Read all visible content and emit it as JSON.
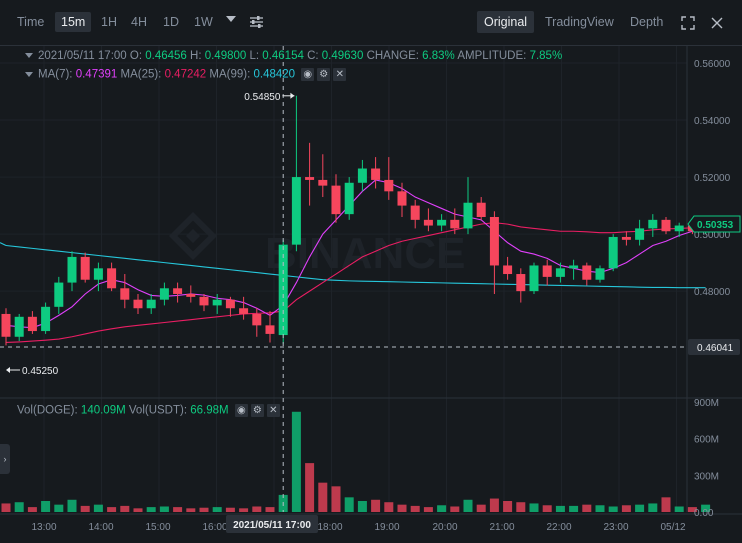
{
  "toolbar": {
    "intervals": [
      "Time",
      "15m",
      "1H",
      "4H",
      "1D",
      "1W"
    ],
    "active_interval": "15m",
    "views": [
      "Original",
      "TradingView",
      "Depth"
    ],
    "active_view": "Original"
  },
  "ohlc_line": {
    "date": "2021/05/11 17:00",
    "o_label": "O:",
    "o_value": "0.46456",
    "h_label": "H:",
    "h_value": "0.49800",
    "l_label": "L:",
    "l_value": "0.46154",
    "c_label": "C:",
    "c_value": "0.49630",
    "change_label": "CHANGE:",
    "change_value": "6.83%",
    "amp_label": "AMPLITUDE:",
    "amp_value": "7.85%"
  },
  "ma_line": {
    "ma7_label": "MA(7):",
    "ma7_value": "0.47391",
    "ma25_label": "MA(25):",
    "ma25_value": "0.47242",
    "ma99_label": "MA(99):",
    "ma99_value": "0.48420"
  },
  "vol_line": {
    "doge_label": "Vol(DOGE):",
    "doge_value": "140.09M",
    "usdt_label": "Vol(USDT):",
    "usdt_value": "66.98M"
  },
  "price_axis": [
    "0.56000",
    "0.54000",
    "0.52000",
    "0.50000",
    "0.48000",
    "0.46041"
  ],
  "vol_axis": [
    "900M",
    "600M",
    "300M",
    "0.00"
  ],
  "time_axis": [
    "13:00",
    "14:00",
    "15:00",
    "16:00",
    "18:00",
    "19:00",
    "20:00",
    "21:00",
    "22:00",
    "23:00",
    "05/12"
  ],
  "crosshair_time": "2021/05/11 17:00",
  "crosshair_price": "0.46041",
  "last_price": "0.50353",
  "high_marker": "0.54850",
  "low_marker": "0.45250",
  "watermark": "BINANCE",
  "colors": {
    "up": "#0ecb81",
    "down": "#f6465d",
    "ma7": "#e040fb",
    "ma25": "#e91e63",
    "ma99": "#26c6da"
  },
  "chart_data": {
    "type": "candlestick",
    "interval": "15m",
    "candles": [
      [
        0.472,
        0.474,
        0.461,
        0.464
      ],
      [
        0.464,
        0.472,
        0.4625,
        0.471
      ],
      [
        0.471,
        0.473,
        0.465,
        0.466
      ],
      [
        0.466,
        0.476,
        0.465,
        0.4745
      ],
      [
        0.4745,
        0.485,
        0.472,
        0.483
      ],
      [
        0.483,
        0.494,
        0.48,
        0.492
      ],
      [
        0.492,
        0.4935,
        0.483,
        0.484
      ],
      [
        0.484,
        0.49,
        0.48,
        0.488
      ],
      [
        0.488,
        0.49,
        0.48,
        0.481
      ],
      [
        0.481,
        0.486,
        0.474,
        0.477
      ],
      [
        0.477,
        0.479,
        0.472,
        0.474
      ],
      [
        0.474,
        0.479,
        0.472,
        0.477
      ],
      [
        0.477,
        0.483,
        0.475,
        0.481
      ],
      [
        0.481,
        0.483,
        0.476,
        0.479
      ],
      [
        0.479,
        0.482,
        0.476,
        0.478
      ],
      [
        0.478,
        0.479,
        0.473,
        0.475
      ],
      [
        0.475,
        0.479,
        0.472,
        0.477
      ],
      [
        0.477,
        0.478,
        0.471,
        0.474
      ],
      [
        0.474,
        0.478,
        0.47,
        0.472
      ],
      [
        0.472,
        0.474,
        0.464,
        0.468
      ],
      [
        0.468,
        0.473,
        0.462,
        0.465
      ],
      [
        0.4646,
        0.498,
        0.4615,
        0.4963
      ],
      [
        0.4963,
        0.5485,
        0.494,
        0.52
      ],
      [
        0.52,
        0.532,
        0.51,
        0.519
      ],
      [
        0.519,
        0.528,
        0.513,
        0.517
      ],
      [
        0.517,
        0.521,
        0.504,
        0.507
      ],
      [
        0.507,
        0.52,
        0.505,
        0.518
      ],
      [
        0.518,
        0.526,
        0.515,
        0.523
      ],
      [
        0.523,
        0.527,
        0.516,
        0.519
      ],
      [
        0.519,
        0.527,
        0.512,
        0.515
      ],
      [
        0.515,
        0.518,
        0.506,
        0.51
      ],
      [
        0.51,
        0.512,
        0.502,
        0.505
      ],
      [
        0.505,
        0.509,
        0.501,
        0.503
      ],
      [
        0.503,
        0.507,
        0.501,
        0.505
      ],
      [
        0.505,
        0.509,
        0.5,
        0.502
      ],
      [
        0.502,
        0.52,
        0.5,
        0.511
      ],
      [
        0.511,
        0.513,
        0.505,
        0.506
      ],
      [
        0.506,
        0.508,
        0.479,
        0.489
      ],
      [
        0.489,
        0.492,
        0.484,
        0.486
      ],
      [
        0.486,
        0.488,
        0.476,
        0.48
      ],
      [
        0.48,
        0.49,
        0.479,
        0.489
      ],
      [
        0.489,
        0.491,
        0.482,
        0.485
      ],
      [
        0.485,
        0.49,
        0.483,
        0.488
      ],
      [
        0.488,
        0.491,
        0.484,
        0.489
      ],
      [
        0.489,
        0.49,
        0.482,
        0.484
      ],
      [
        0.484,
        0.489,
        0.483,
        0.488
      ],
      [
        0.488,
        0.5,
        0.487,
        0.499
      ],
      [
        0.499,
        0.501,
        0.496,
        0.498
      ],
      [
        0.498,
        0.505,
        0.496,
        0.502
      ],
      [
        0.502,
        0.507,
        0.499,
        0.505
      ],
      [
        0.505,
        0.506,
        0.5,
        0.501
      ],
      [
        0.501,
        0.504,
        0.499,
        0.503
      ],
      [
        0.503,
        0.504,
        0.5,
        0.501
      ],
      [
        0.501,
        0.504,
        0.5,
        0.5035
      ]
    ],
    "volumes_millions": [
      70,
      80,
      40,
      90,
      60,
      100,
      50,
      60,
      40,
      50,
      30,
      40,
      45,
      40,
      30,
      35,
      40,
      35,
      30,
      45,
      40,
      140,
      820,
      400,
      240,
      210,
      120,
      90,
      100,
      80,
      60,
      50,
      40,
      55,
      45,
      100,
      60,
      110,
      90,
      80,
      70,
      55,
      50,
      50,
      60,
      55,
      45,
      55,
      60,
      70,
      120,
      45,
      40,
      60
    ],
    "ma7_series": [
      0.468,
      0.4675,
      0.4672,
      0.4688,
      0.4715,
      0.4745,
      0.479,
      0.4825,
      0.484,
      0.483,
      0.4805,
      0.4785,
      0.4782,
      0.4785,
      0.479,
      0.4786,
      0.4775,
      0.477,
      0.476,
      0.474,
      0.4715,
      0.475,
      0.483,
      0.492,
      0.5,
      0.505,
      0.51,
      0.515,
      0.519,
      0.518,
      0.516,
      0.513,
      0.511,
      0.509,
      0.507,
      0.506,
      0.505,
      0.501,
      0.497,
      0.494,
      0.493,
      0.4915,
      0.489,
      0.488,
      0.487,
      0.4865,
      0.488,
      0.49,
      0.493,
      0.496,
      0.4975,
      0.4995,
      0.501,
      0.503
    ],
    "ma25_series": [
      0.462,
      0.4622,
      0.4625,
      0.4628,
      0.4632,
      0.464,
      0.465,
      0.466,
      0.4668,
      0.4675,
      0.468,
      0.4685,
      0.469,
      0.4695,
      0.47,
      0.4705,
      0.471,
      0.4715,
      0.472,
      0.4722,
      0.4724,
      0.473,
      0.477,
      0.48,
      0.483,
      0.486,
      0.489,
      0.492,
      0.494,
      0.496,
      0.4975,
      0.4985,
      0.4995,
      0.5005,
      0.5015,
      0.5025,
      0.5035,
      0.504,
      0.5035,
      0.5025,
      0.502,
      0.5015,
      0.501,
      0.501,
      0.5008,
      0.5005,
      0.5005,
      0.5008,
      0.501,
      0.5015,
      0.5018,
      0.502,
      0.5022,
      0.5024
    ],
    "ma99_series": [
      0.496,
      0.4955,
      0.495,
      0.4945,
      0.494,
      0.4935,
      0.493,
      0.4925,
      0.492,
      0.4915,
      0.491,
      0.4905,
      0.49,
      0.4895,
      0.489,
      0.4885,
      0.488,
      0.4875,
      0.487,
      0.4865,
      0.486,
      0.4855,
      0.485,
      0.4845,
      0.484,
      0.4838,
      0.4836,
      0.4835,
      0.4834,
      0.4833,
      0.4832,
      0.4831,
      0.483,
      0.4829,
      0.4828,
      0.4827,
      0.4826,
      0.4825,
      0.4824,
      0.4823,
      0.4822,
      0.4821,
      0.482,
      0.4819,
      0.4818,
      0.4817,
      0.4816,
      0.4815,
      0.4814,
      0.4813,
      0.4813,
      0.4812,
      0.4812,
      0.4812
    ],
    "ylim": [
      0.449,
      0.564
    ],
    "vol_ylim": [
      0,
      900
    ]
  }
}
